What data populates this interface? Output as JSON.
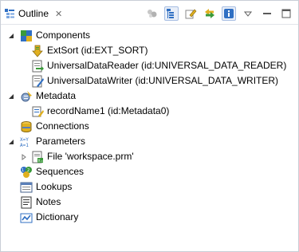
{
  "view": {
    "title": "Outline",
    "close_glyph": "✕"
  },
  "toolbar": {
    "buttons": [
      "sort-icon",
      "tree-layout-icon",
      "edit-icon",
      "link-icon",
      "info-icon",
      "view-menu-icon",
      "minimize-icon",
      "maximize-icon"
    ]
  },
  "tree": {
    "components": {
      "label": "Components",
      "children": [
        "ExtSort (id:EXT_SORT)",
        "UniversalDataReader (id:UNIVERSAL_DATA_READER)",
        "UniversalDataWriter (id:UNIVERSAL_DATA_WRITER)"
      ]
    },
    "metadata": {
      "label": "Metadata",
      "children": [
        "recordName1 (id:Metadata0)"
      ]
    },
    "connections": {
      "label": "Connections"
    },
    "parameters": {
      "label": "Parameters",
      "children": [
        "File 'workspace.prm'"
      ]
    },
    "sequences": {
      "label": "Sequences"
    },
    "lookups": {
      "label": "Lookups"
    },
    "notes": {
      "label": "Notes"
    },
    "dictionary": {
      "label": "Dictionary"
    }
  },
  "colors": {
    "border": "#c9ced6",
    "accent_blue": "#2f6fc3",
    "accent_green": "#3a9a3a",
    "accent_yellow": "#e0b020"
  }
}
